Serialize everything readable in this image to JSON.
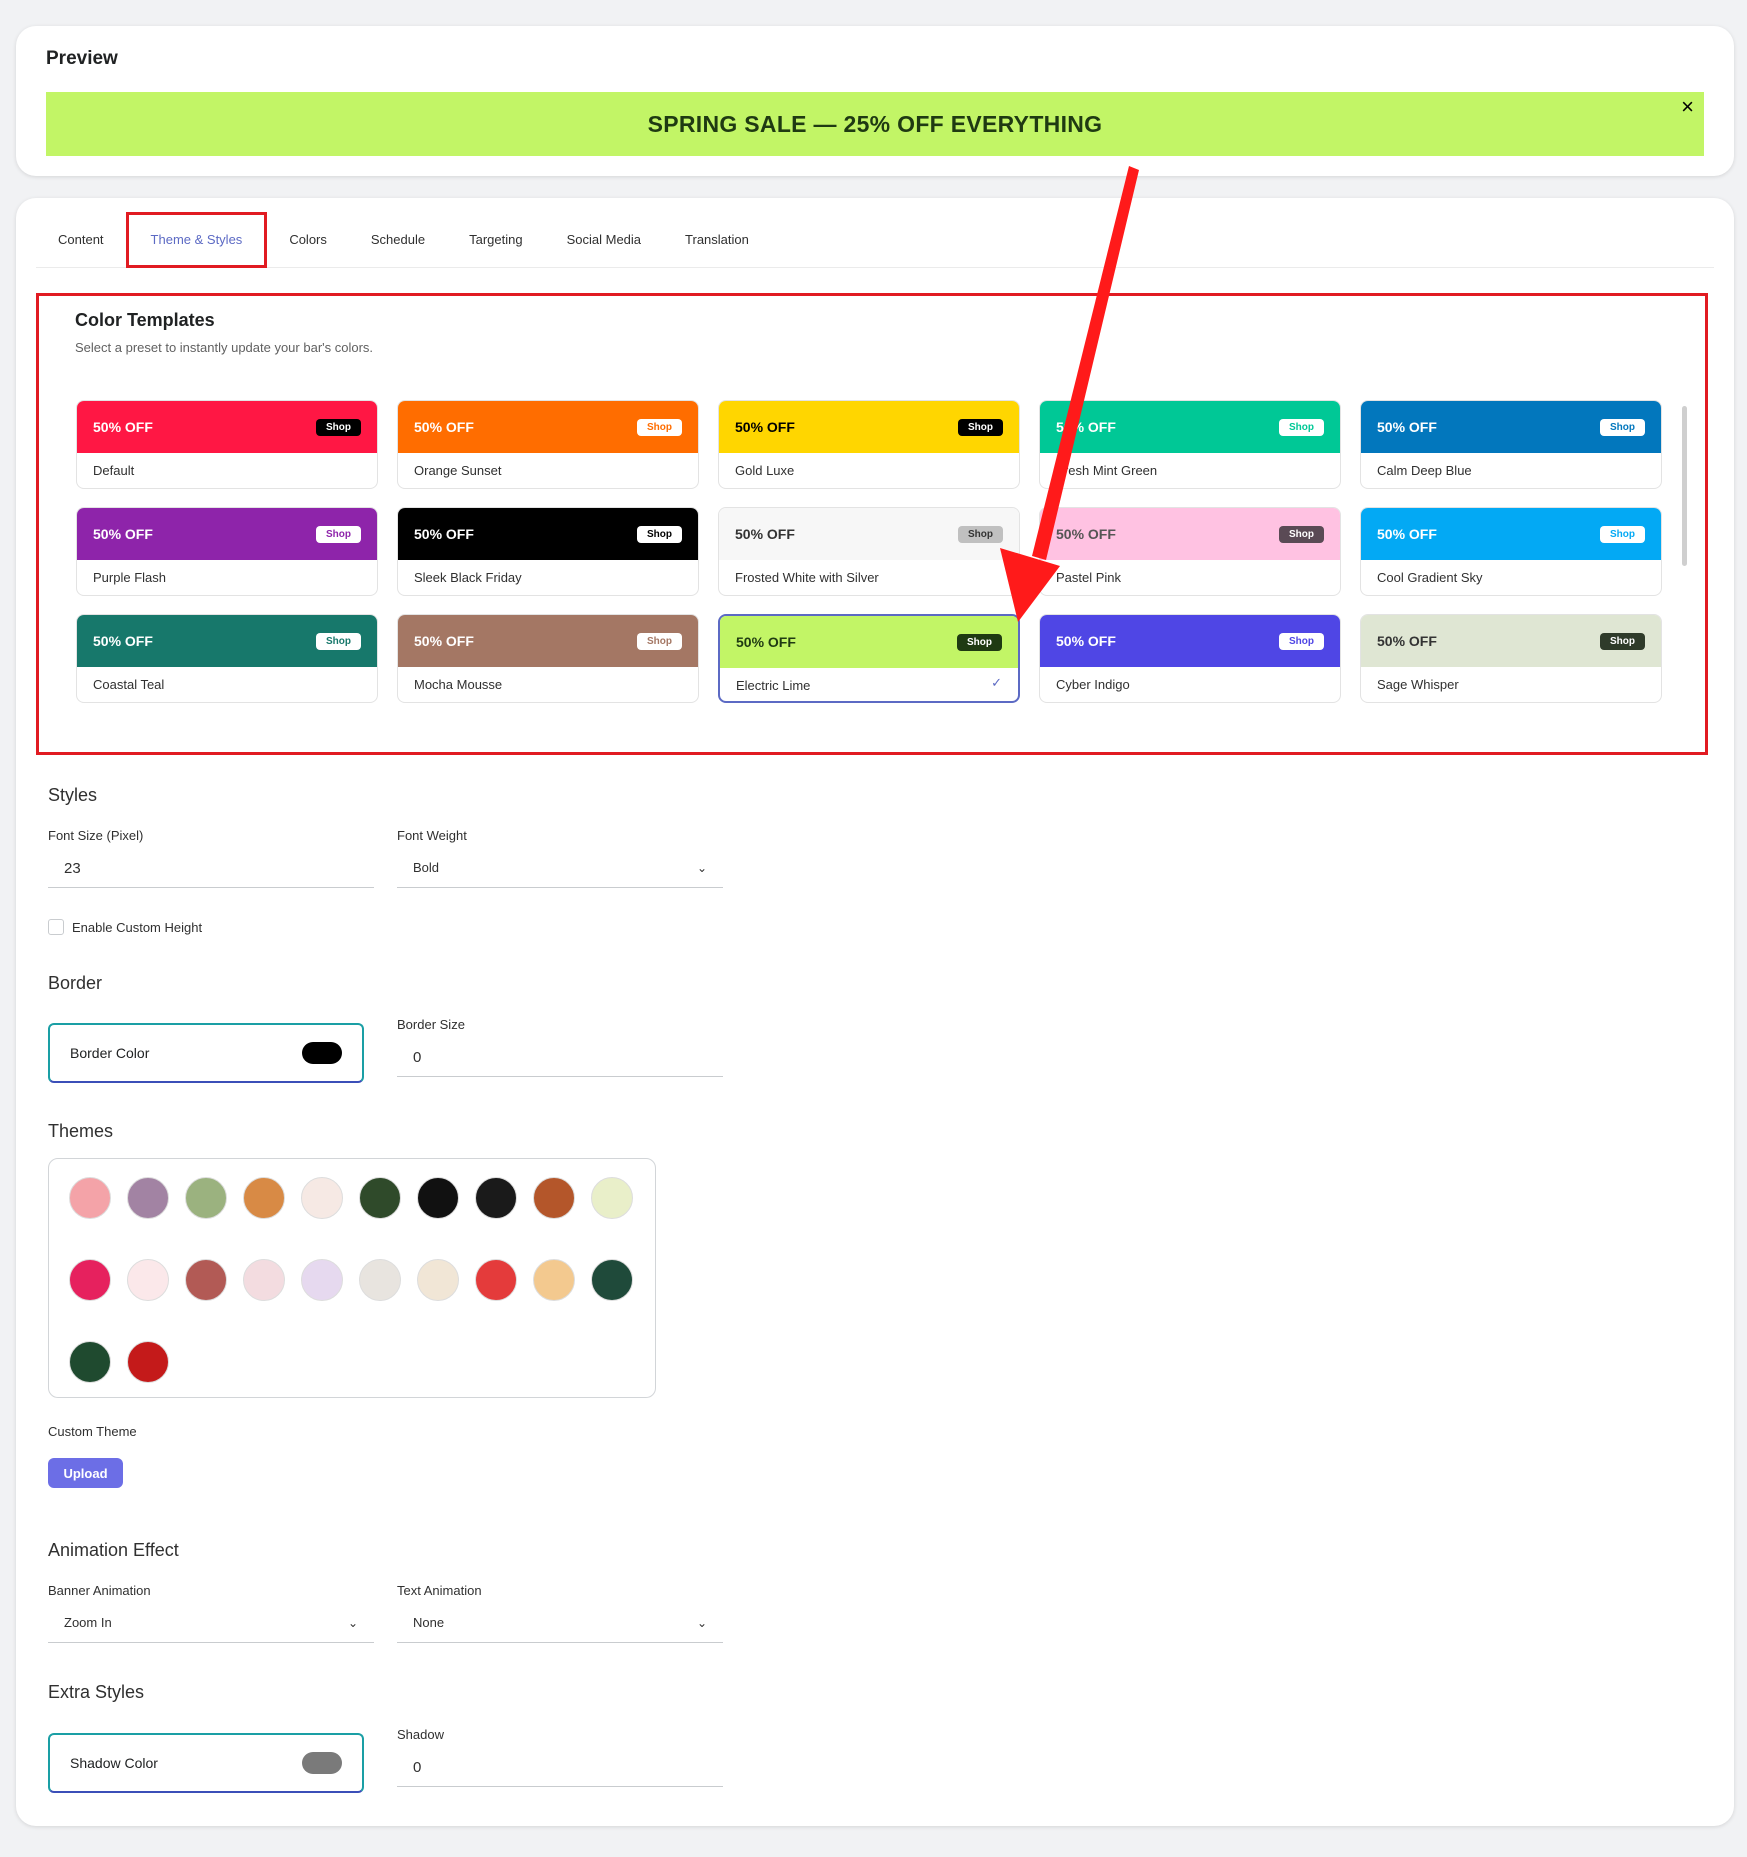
{
  "preview": {
    "title": "Preview",
    "banner_text": "SPRING SALE — 25% OFF EVERYTHING",
    "close_symbol": "×"
  },
  "tabs": [
    {
      "label": "Content"
    },
    {
      "label": "Theme & Styles",
      "active": true
    },
    {
      "label": "Colors"
    },
    {
      "label": "Schedule"
    },
    {
      "label": "Targeting"
    },
    {
      "label": "Social Media"
    },
    {
      "label": "Translation"
    }
  ],
  "color_templates": {
    "title": "Color Templates",
    "subtitle": "Select a preset to instantly update your bar's colors.",
    "offer_text": "50% OFF",
    "shop_text": "Shop",
    "items": [
      {
        "name": "Default",
        "bg": "#ff1744",
        "text": "#ffffff",
        "btn_bg": "#000000",
        "btn_text": "#ffffff"
      },
      {
        "name": "Orange Sunset",
        "bg": "#ff6d00",
        "text": "#ffffff",
        "btn_bg": "#ffffff",
        "btn_text": "#ff6d00"
      },
      {
        "name": "Gold Luxe",
        "bg": "#ffd600",
        "text": "#000000",
        "btn_bg": "#000000",
        "btn_text": "#ffffff"
      },
      {
        "name": "Fresh Mint Green",
        "bg": "#00c896",
        "text": "#ffffff",
        "btn_bg": "#ffffff",
        "btn_text": "#00c896"
      },
      {
        "name": "Calm Deep Blue",
        "bg": "#0277bd",
        "text": "#ffffff",
        "btn_bg": "#ffffff",
        "btn_text": "#0277bd"
      },
      {
        "name": "Purple Flash",
        "bg": "#8e24aa",
        "text": "#ffffff",
        "btn_bg": "#ffffff",
        "btn_text": "#8e24aa"
      },
      {
        "name": "Sleek Black Friday",
        "bg": "#000000",
        "text": "#ffffff",
        "btn_bg": "#ffffff",
        "btn_text": "#000000"
      },
      {
        "name": "Frosted White with Silver",
        "bg": "#f7f7f7",
        "text": "#333333",
        "btn_bg": "#c0c0c0",
        "btn_text": "#333333"
      },
      {
        "name": "Pastel Pink",
        "bg": "#ffc2e2",
        "text": "#555555",
        "btn_bg": "#5a4a55",
        "btn_text": "#ffffff"
      },
      {
        "name": "Cool Gradient Sky",
        "bg": "#03a9f4",
        "text": "#ffffff",
        "btn_bg": "#ffffff",
        "btn_text": "#03a9f4"
      },
      {
        "name": "Coastal Teal",
        "bg": "#17786b",
        "text": "#ffffff",
        "btn_bg": "#ffffff",
        "btn_text": "#17786b"
      },
      {
        "name": "Mocha Mousse",
        "bg": "#a47764",
        "text": "#ffffff",
        "btn_bg": "#ffffff",
        "btn_text": "#a47764"
      },
      {
        "name": "Electric Lime",
        "bg": "#c2f566",
        "text": "#1f3a12",
        "btn_bg": "#1f3a12",
        "btn_text": "#ffffff",
        "selected": true
      },
      {
        "name": "Cyber Indigo",
        "bg": "#4f46e5",
        "text": "#ffffff",
        "btn_bg": "#ffffff",
        "btn_text": "#4f46e5"
      },
      {
        "name": "Sage Whisper",
        "bg": "#dfe6d3",
        "text": "#333333",
        "btn_bg": "#2f3b2a",
        "btn_text": "#ffffff"
      }
    ]
  },
  "styles": {
    "title": "Styles",
    "font_size_label": "Font Size (Pixel)",
    "font_size_value": "23",
    "font_weight_label": "Font Weight",
    "font_weight_value": "Bold",
    "custom_height_label": "Enable Custom Height"
  },
  "border": {
    "title": "Border",
    "color_label": "Border Color",
    "color_value": "#000000",
    "size_label": "Border Size",
    "size_value": "0"
  },
  "themes": {
    "title": "Themes",
    "items": [
      {
        "icon": "pink-lattice-pattern-icon",
        "color": "#f4a3a8"
      },
      {
        "icon": "mauve-triangle-pattern-icon",
        "color": "#a283a3"
      },
      {
        "icon": "sage-green-pattern-icon",
        "color": "#9bb27f"
      },
      {
        "icon": "orange-swirl-pattern-icon",
        "color": "#d88a45"
      },
      {
        "icon": "sale-text-pattern-icon",
        "color": "#f6e9e4"
      },
      {
        "icon": "dollar-pattern-icon",
        "color": "#2f4a2a"
      },
      {
        "icon": "black-burst-pattern-icon",
        "color": "#111111"
      },
      {
        "icon": "shopping-cart-icon",
        "color": "#1a1a1a"
      },
      {
        "icon": "pumpkin-icon",
        "color": "#b4562a"
      },
      {
        "icon": "green-floral-pattern-icon",
        "color": "#e9efc9"
      },
      {
        "icon": "heart-icon",
        "color": "#e6215e"
      },
      {
        "icon": "snowflake-pattern-icon",
        "color": "#fbe8ea"
      },
      {
        "icon": "red-snowflake-pattern-icon",
        "color": "#b25a55"
      },
      {
        "icon": "shopping-bag-icon",
        "color": "#f3dce0"
      },
      {
        "icon": "dollar-bag-icon",
        "color": "#e6d9ef"
      },
      {
        "icon": "percent-tag-outline-icon",
        "color": "#e8e4df"
      },
      {
        "icon": "percent-badge-icon",
        "color": "#f1e6d6"
      },
      {
        "icon": "red-gift-icon",
        "color": "#e43b3b"
      },
      {
        "icon": "christmas-tree-icon",
        "color": "#f3c98f"
      },
      {
        "icon": "snowman-icon",
        "color": "#1f4a3a"
      },
      {
        "icon": "holly-leaf-icon",
        "color": "#1f4a2f"
      },
      {
        "icon": "red-ornament-icon",
        "color": "#c41a1a"
      }
    ]
  },
  "custom_theme": {
    "label": "Custom Theme",
    "upload_label": "Upload"
  },
  "animation": {
    "title": "Animation Effect",
    "banner_label": "Banner Animation",
    "banner_value": "Zoom In",
    "text_label": "Text Animation",
    "text_value": "None"
  },
  "extra": {
    "title": "Extra Styles",
    "shadow_color_label": "Shadow Color",
    "shadow_color_value": "#7a7a7a",
    "shadow_label": "Shadow",
    "shadow_value": "0"
  },
  "annotation_color": "#e11b22"
}
